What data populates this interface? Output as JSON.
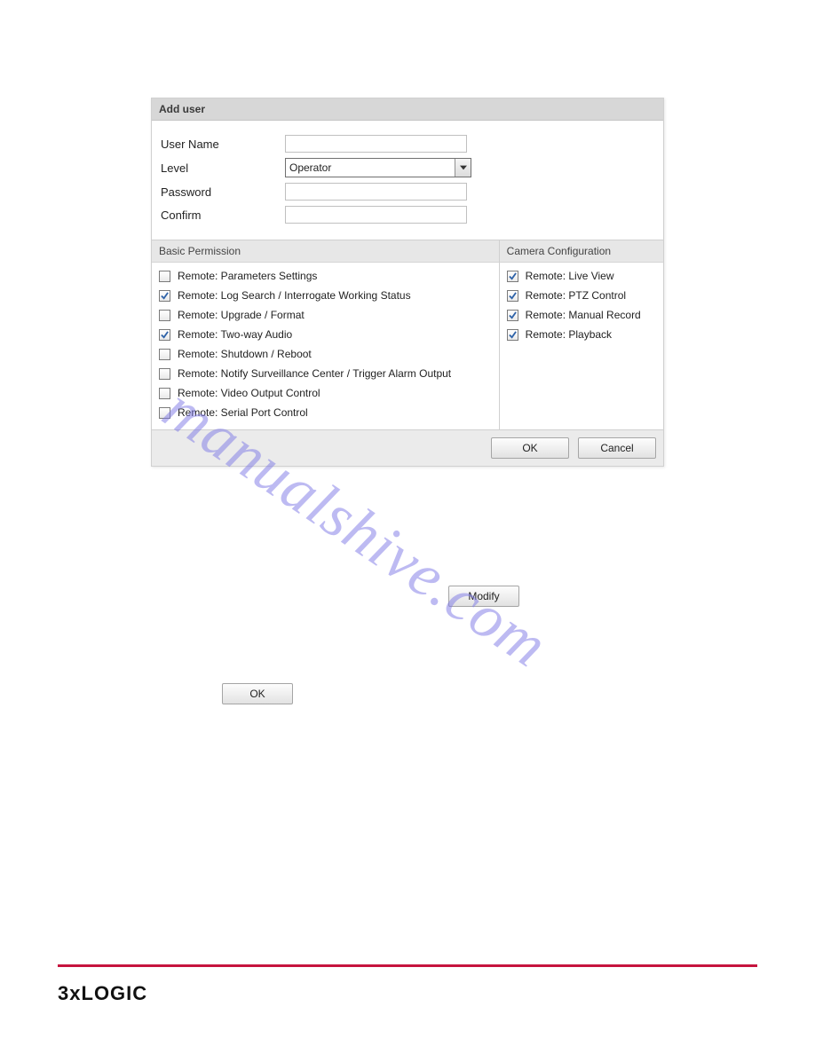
{
  "dialog": {
    "title": "Add user",
    "fields": {
      "username_label": "User Name",
      "username_value": "",
      "level_label": "Level",
      "level_value": "Operator",
      "password_label": "Password",
      "password_value": "",
      "confirm_label": "Confirm",
      "confirm_value": ""
    },
    "basic_title": "Basic Permission",
    "camera_title": "Camera Configuration",
    "basic": [
      {
        "label": "Remote: Parameters Settings",
        "checked": false
      },
      {
        "label": "Remote: Log Search / Interrogate Working Status",
        "checked": true
      },
      {
        "label": "Remote: Upgrade / Format",
        "checked": false
      },
      {
        "label": "Remote: Two-way Audio",
        "checked": true
      },
      {
        "label": "Remote: Shutdown / Reboot",
        "checked": false
      },
      {
        "label": "Remote: Notify Surveillance Center / Trigger Alarm Output",
        "checked": false
      },
      {
        "label": "Remote: Video Output Control",
        "checked": false
      },
      {
        "label": "Remote: Serial Port Control",
        "checked": false
      }
    ],
    "camera": [
      {
        "label": "Remote: Live View",
        "checked": true
      },
      {
        "label": "Remote: PTZ Control",
        "checked": true
      },
      {
        "label": "Remote: Manual Record",
        "checked": true
      },
      {
        "label": "Remote: Playback",
        "checked": true
      }
    ],
    "ok_label": "OK",
    "cancel_label": "Cancel"
  },
  "standalone": {
    "modify_label": "Modify",
    "ok_label": "OK"
  },
  "watermark": "manualshive.com",
  "footer": {
    "brand_prefix": "3",
    "brand_x": "x",
    "brand_suffix": "LOGIC"
  }
}
